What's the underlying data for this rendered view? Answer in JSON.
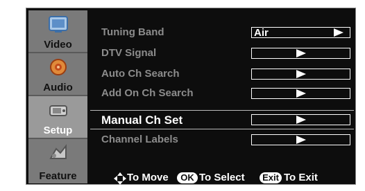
{
  "nav": {
    "items": [
      {
        "label": "Video",
        "icon": "video-icon"
      },
      {
        "label": "Audio",
        "icon": "audio-icon"
      },
      {
        "label": "Setup",
        "icon": "setup-icon",
        "active": true
      },
      {
        "label": "Feature",
        "icon": "feature-icon"
      }
    ]
  },
  "menu": {
    "rows": [
      {
        "label": "Tuning Band",
        "value": "Air"
      },
      {
        "label": "DTV Signal",
        "value": ""
      },
      {
        "label": "Auto Ch Search",
        "value": ""
      },
      {
        "label": "Add On Ch Search",
        "value": ""
      },
      {
        "label": "Manual Ch Set",
        "value": "",
        "selected": true
      },
      {
        "label": "Channel Labels",
        "value": ""
      }
    ]
  },
  "footer": {
    "move": "To Move",
    "ok": "OK",
    "select": "To Select",
    "exit_key": "Exit",
    "exit": "To Exit"
  },
  "colors": {
    "panel": "#0d0d0d",
    "nav": "#7a7a7a",
    "text_dim": "#8c8c8c",
    "text": "#ffffff"
  }
}
